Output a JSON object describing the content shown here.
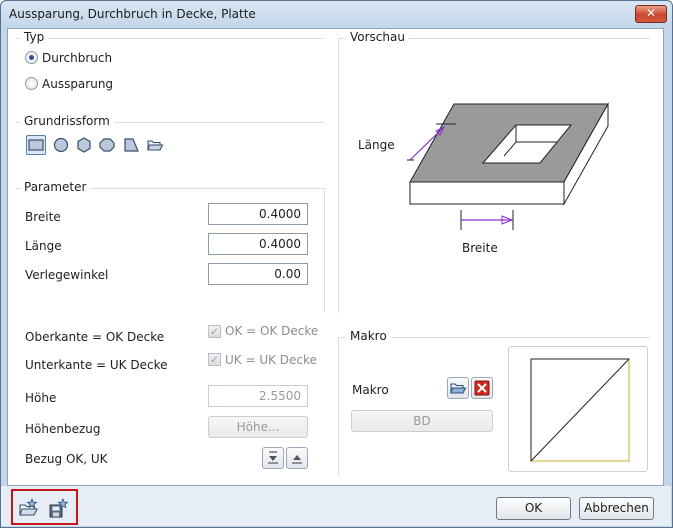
{
  "window": {
    "title": "Aussparung, Durchbruch in Decke, Platte",
    "close_glyph": "✕"
  },
  "typ": {
    "title": "Typ",
    "options": [
      {
        "label": "Durchbruch",
        "selected": true
      },
      {
        "label": "Aussparung",
        "selected": false
      }
    ]
  },
  "grundriss": {
    "title": "Grundrissform",
    "shapes": [
      "rectangle-icon",
      "circle-icon",
      "hexagon-icon",
      "octagon-icon",
      "trapezoid-icon",
      "open-folder-icon"
    ]
  },
  "parameter": {
    "title": "Parameter",
    "breite_label": "Breite",
    "breite_value": "0.4000",
    "laenge_label": "Länge",
    "laenge_value": "0.4000",
    "winkel_label": "Verlegewinkel",
    "winkel_value": "0.00",
    "oberkante_label": "Oberkante = OK Decke",
    "ok_check_label": "OK = OK Decke",
    "unterkante_label": "Unterkante = UK Decke",
    "uk_check_label": "UK = UK Decke",
    "hoehe_label": "Höhe",
    "hoehe_value": "2.5500",
    "hoehenbezug_label": "Höhenbezug",
    "hoehenbezug_button": "Höhe...",
    "bezug_label": "Bezug OK, UK"
  },
  "vorschau": {
    "title": "Vorschau",
    "laenge_label": "Länge",
    "breite_label": "Breite"
  },
  "makro": {
    "title": "Makro",
    "label": "Makro",
    "bd_button": "BD"
  },
  "footer": {
    "ok_label": "OK",
    "cancel_label": "Abbrechen"
  },
  "colors": {
    "accent_line": "#8b2fc9",
    "highlight_box": "#c0161c",
    "slab_gray": "#9a9a9a"
  }
}
